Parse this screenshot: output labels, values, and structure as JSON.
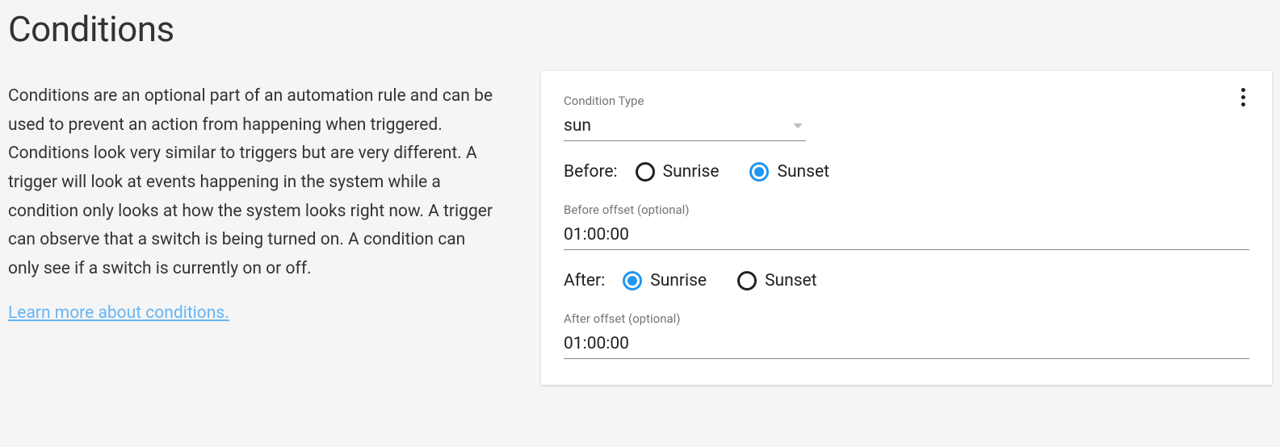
{
  "section": {
    "title": "Conditions",
    "description": "Conditions are an optional part of an automation rule and can be used to prevent an action from happening when triggered. Conditions look very similar to triggers but are very different. A trigger will look at events happening in the system while a condition only looks at how the system looks right now. A trigger can observe that a switch is being turned on. A condition can only see if a switch is currently on or off.",
    "learn_more": "Learn more about conditions."
  },
  "card": {
    "condition_type_label": "Condition Type",
    "condition_type_value": "sun",
    "before": {
      "label": "Before:",
      "options": {
        "sunrise": "Sunrise",
        "sunset": "Sunset"
      },
      "selected": "sunset",
      "offset_label": "Before offset (optional)",
      "offset_value": "01:00:00"
    },
    "after": {
      "label": "After:",
      "options": {
        "sunrise": "Sunrise",
        "sunset": "Sunset"
      },
      "selected": "sunrise",
      "offset_label": "After offset (optional)",
      "offset_value": "01:00:00"
    }
  }
}
